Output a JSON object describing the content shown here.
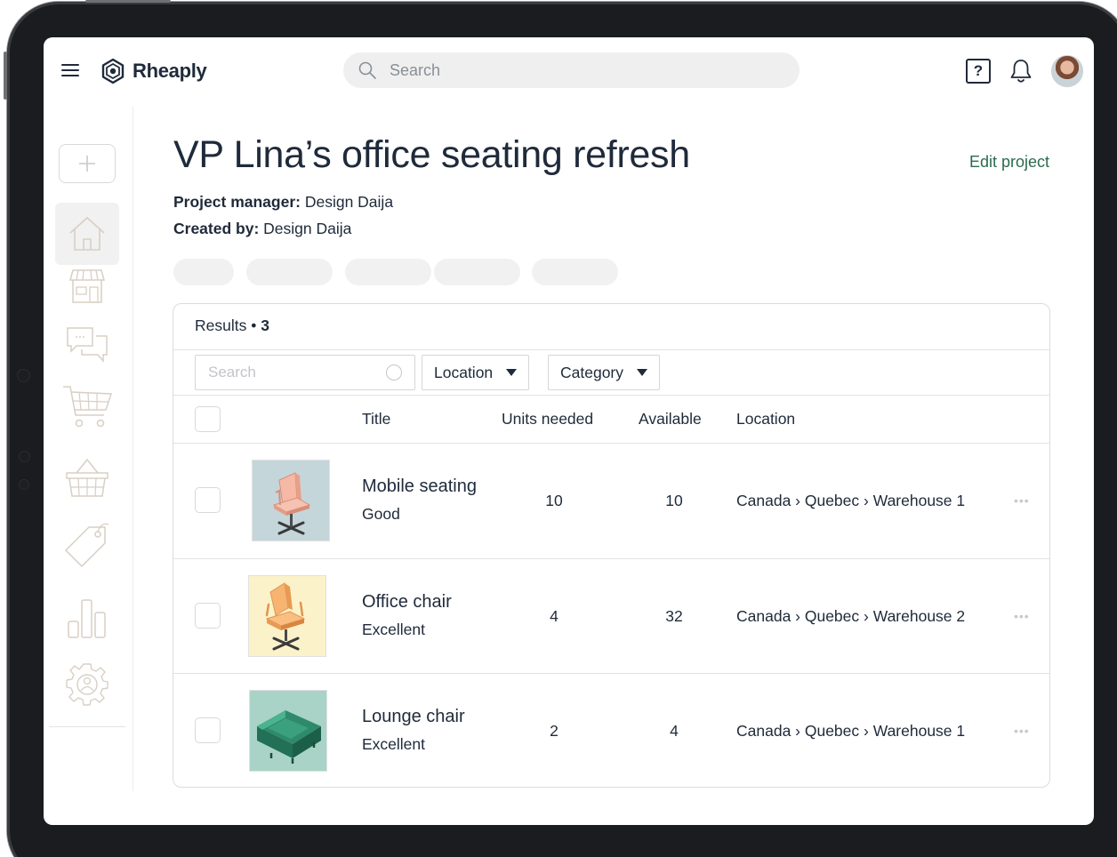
{
  "app": {
    "name": "Rheaply"
  },
  "topbar": {
    "search_placeholder": "Search",
    "help_glyph": "?"
  },
  "sidebar": {
    "new_icon": "plus-icon",
    "items": [
      {
        "icon": "home-icon",
        "active": true
      },
      {
        "icon": "storefront-icon",
        "active": false
      },
      {
        "icon": "chat-bubbles-icon",
        "active": false
      },
      {
        "icon": "shopping-cart-icon",
        "active": false
      },
      {
        "icon": "basket-icon",
        "active": false
      },
      {
        "icon": "tag-icon",
        "active": false
      },
      {
        "icon": "bar-chart-icon",
        "active": false
      },
      {
        "icon": "settings-gear-icon",
        "active": false
      }
    ]
  },
  "project": {
    "title": "VP Lina’s office seating refresh",
    "edit_label": "Edit project",
    "manager_label": "Project manager:",
    "manager_value": " Design Daija",
    "created_label": "Created by:",
    "created_value": " Design Daija"
  },
  "results": {
    "label": "Results",
    "separator": " • ",
    "count": "3",
    "search_placeholder": "Search",
    "filters": {
      "location": "Location",
      "category": "Category"
    },
    "columns": {
      "title": "Title",
      "units_needed": "Units needed",
      "available": "Available",
      "location": "Location"
    },
    "rows": [
      {
        "title": "Mobile seating",
        "condition": "Good",
        "units_needed": "10",
        "available": "10",
        "location": "Canada › Quebec › Warehouse 1",
        "more": "•••",
        "thumb_bg": "#c4d6da"
      },
      {
        "title": "Office chair",
        "condition": "Excellent",
        "units_needed": "4",
        "available": "32",
        "location": "Canada › Quebec › Warehouse 2",
        "more": "•••",
        "thumb_bg": "#fbf2c9"
      },
      {
        "title": "Lounge chair",
        "condition": "Excellent",
        "units_needed": "2",
        "available": "4",
        "location": "Canada › Quebec › Warehouse 1",
        "more": "•••",
        "thumb_bg": "#a9d3c7"
      }
    ]
  },
  "colors": {
    "accent": "#2b6b4e",
    "text": "#1f2a3a",
    "frame": "#1b1c1f"
  }
}
